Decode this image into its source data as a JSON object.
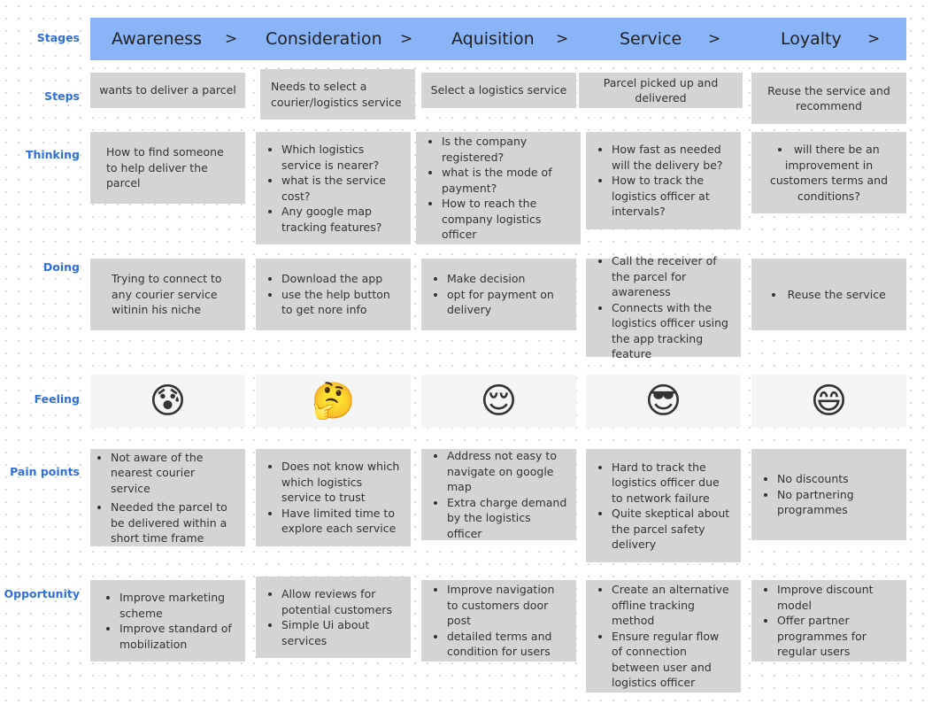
{
  "stages": [
    {
      "label": "Awareness",
      "arrow": ">"
    },
    {
      "label": "Consideration",
      "arrow": ">"
    },
    {
      "label": "Aquisition",
      "arrow": ">"
    },
    {
      "label": "Service",
      "arrow": ">"
    },
    {
      "label": "Loyalty",
      "arrow": ">"
    }
  ],
  "row_labels": {
    "stages": "Stages",
    "steps": "Steps",
    "thinking": "Thinking",
    "doing": "Doing",
    "feeling": "Feeling",
    "pain_points": "Pain points",
    "opportunity": "Opportunity"
  },
  "steps": [
    "wants to deliver a parcel",
    "Needs to select a courier/logistics service",
    "Select a logistics service",
    "Parcel picked up and delivered",
    "Reuse the service and recommend"
  ],
  "thinking": [
    {
      "text": "How to find someone to help deliver the parcel"
    },
    {
      "items": [
        "Which logistics service is nearer?",
        "what is the service cost?",
        "Any google map tracking features?"
      ]
    },
    {
      "items": [
        "Is the company registered?",
        "what is the mode of payment?",
        "How to reach the company logistics officer"
      ]
    },
    {
      "items": [
        "How fast as needed will the delivery be?",
        "How to track the logistics officer at intervals?"
      ]
    },
    {
      "items": [
        "will there be an improvement in customers terms and conditions?"
      ]
    }
  ],
  "doing": [
    {
      "text": "Trying to connect to any courier service witinin his niche"
    },
    {
      "items": [
        "Download the app",
        "use the help button to get nore info"
      ]
    },
    {
      "items": [
        "Make decision",
        "opt for payment on delivery"
      ]
    },
    {
      "items": [
        "Call the receiver of the parcel for awareness",
        "Connects with the logistics officer using the app tracking feature"
      ]
    },
    {
      "items": [
        "Reuse the service"
      ]
    }
  ],
  "feeling": [
    {
      "icon": "anxious-sweat-face-icon",
      "glyph": "😰"
    },
    {
      "icon": "thinking-sunglasses-face-icon",
      "glyph": "🤔"
    },
    {
      "icon": "relieved-face-icon",
      "glyph": "😌"
    },
    {
      "icon": "sunglasses-face-icon",
      "glyph": "😎"
    },
    {
      "icon": "grinning-face-icon",
      "glyph": "😄"
    }
  ],
  "pain_points": [
    [
      "Not aware of the nearest courier service",
      "Needed the parcel to be delivered within a short time frame"
    ],
    [
      "Does not know which which logistics service to trust",
      "Have limited time to explore each service"
    ],
    [
      "Address not easy to navigate on google map",
      "Extra charge demand by the logistics officer"
    ],
    [
      "Hard to track the logistics officer due to network failure",
      "Quite skeptical about the parcel safety delivery"
    ],
    [
      "No discounts",
      "No partnering programmes"
    ]
  ],
  "opportunity": [
    [
      "Improve marketing scheme",
      "Improve standard of mobilization"
    ],
    [
      "Allow reviews for potential customers",
      "Simple Ui about services"
    ],
    [
      "Improve navigation to customers door post",
      "detailed terms and condition for users"
    ],
    [
      "Create an alternative offline tracking method",
      "Ensure regular flow of connection between user and logistics officer"
    ],
    [
      "Improve discount model",
      "Offer partner programmes for  regular users"
    ]
  ],
  "colors": {
    "stage_bar": "#8ab4f8",
    "card": "#d4d4d4",
    "row_label": "#2f6fdb",
    "feeling_card": "#f5f5f5"
  }
}
